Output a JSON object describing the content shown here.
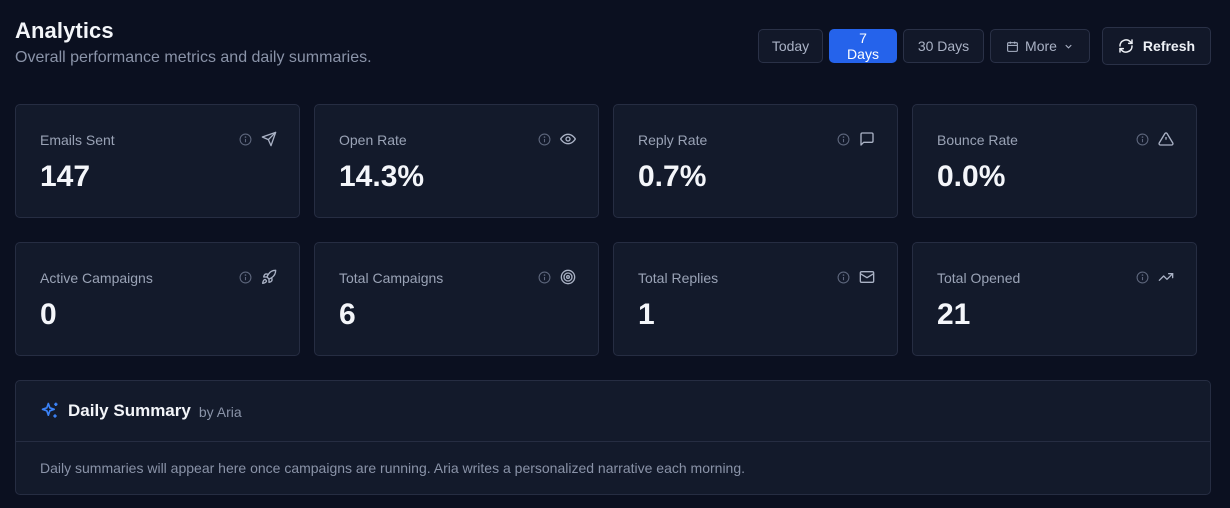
{
  "header": {
    "title": "Analytics",
    "subtitle": "Overall performance metrics and daily summaries."
  },
  "range_buttons": {
    "today": "Today",
    "seven_days": "7 Days",
    "thirty_days": "30 Days",
    "more": "More",
    "active": "7 Days"
  },
  "refresh_label": "Refresh",
  "metrics_row1": [
    {
      "label": "Emails Sent",
      "value": "147",
      "icon": "send-icon"
    },
    {
      "label": "Open Rate",
      "value": "14.3%",
      "icon": "eye-icon"
    },
    {
      "label": "Reply Rate",
      "value": "0.7%",
      "icon": "message-icon"
    },
    {
      "label": "Bounce Rate",
      "value": "0.0%",
      "icon": "warning-icon"
    }
  ],
  "metrics_row2": [
    {
      "label": "Active Campaigns",
      "value": "0",
      "icon": "rocket-icon"
    },
    {
      "label": "Total Campaigns",
      "value": "6",
      "icon": "target-icon"
    },
    {
      "label": "Total Replies",
      "value": "1",
      "icon": "mail-icon"
    },
    {
      "label": "Total Opened",
      "value": "21",
      "icon": "trending-up-icon"
    }
  ],
  "daily_summary": {
    "title": "Daily Summary",
    "by": "by Aria",
    "body": "Daily summaries will appear here once campaigns are running. Aria writes a personalized narrative each morning."
  },
  "colors": {
    "background": "#0b1020",
    "card": "#131a2b",
    "border": "#262d42",
    "accent": "#2563eb"
  }
}
